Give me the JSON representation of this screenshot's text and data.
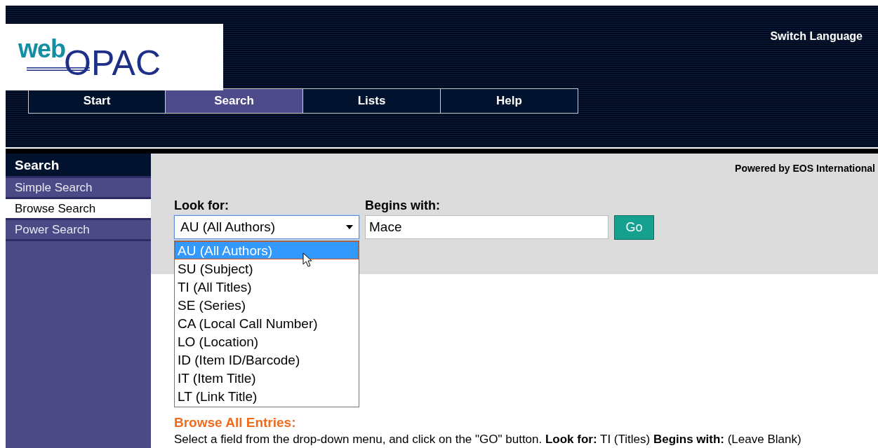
{
  "logo": {
    "prefix": "web",
    "name": "OPAC"
  },
  "header_link": "Switch Language",
  "nav_tabs": [
    {
      "label": "Start",
      "selected": false
    },
    {
      "label": "Search",
      "selected": true
    },
    {
      "label": "Lists",
      "selected": false
    },
    {
      "label": "Help",
      "selected": false
    }
  ],
  "powered_by": "Powered by EOS International",
  "sidebar": {
    "title": "Search",
    "items": [
      {
        "label": "Simple Search",
        "selected": false
      },
      {
        "label": "Browse Search",
        "selected": true
      },
      {
        "label": "Power Search",
        "selected": false
      }
    ]
  },
  "form": {
    "look_for_label": "Look for:",
    "look_for_value": "AU (All Authors)",
    "begins_with_label": "Begins with:",
    "begins_with_value": "Mace",
    "go_button": "Go"
  },
  "dropdown": {
    "expanded": true,
    "options": [
      {
        "label": "AU (All Authors)",
        "selected": true
      },
      {
        "label": "SU (Subject)",
        "selected": false
      },
      {
        "label": "TI (All Titles)",
        "selected": false
      },
      {
        "label": "SE (Series)",
        "selected": false
      },
      {
        "label": "CA (Local Call Number)",
        "selected": false
      },
      {
        "label": "LO (Location)",
        "selected": false
      },
      {
        "label": "ID (Item ID/Barcode)",
        "selected": false
      },
      {
        "label": "IT (Item Title)",
        "selected": false
      },
      {
        "label": "LT (Link Title)",
        "selected": false
      }
    ]
  },
  "help": {
    "heading": "Browse All Entries:",
    "text": "Select a field from the drop-down menu, and click on the \"GO\" button. **Look for:** TI (Titles) **Begins with:** (Leave Blank)"
  }
}
